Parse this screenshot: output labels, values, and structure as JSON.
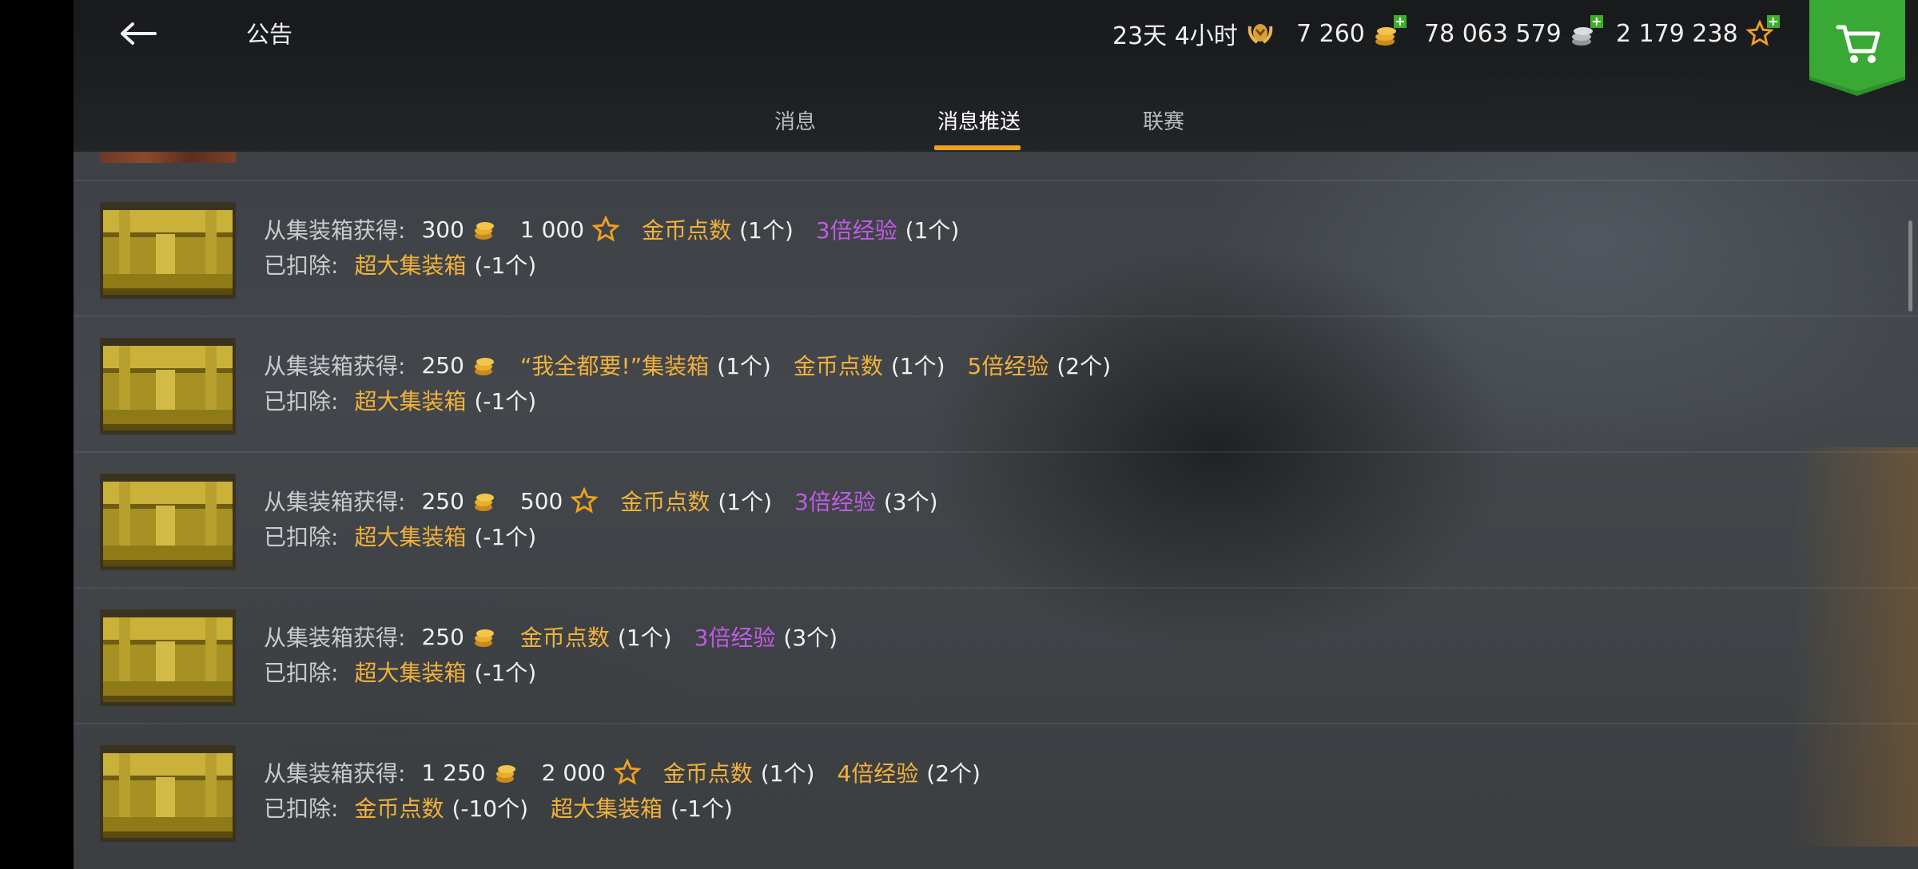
{
  "header": {
    "title": "公告",
    "premium": "23天 4小时",
    "gold": "7 260",
    "credits": "78 063 579",
    "free_xp": "2 179 238"
  },
  "tabs": [
    {
      "label": "消息",
      "active": false
    },
    {
      "label": "消息推送",
      "active": true
    },
    {
      "label": "联赛",
      "active": false
    }
  ],
  "labels": {
    "obtained": "从集装箱获得:",
    "deducted": "已扣除:"
  },
  "colors": {
    "gold_text": "#f1b13c",
    "purple_text": "#c05be6",
    "tab_accent": "#f0a020",
    "plus_green": "#3fae2a"
  },
  "rows": [
    {
      "gold": "300",
      "credits": "1 000",
      "items": [
        {
          "name": "金币点数",
          "count": "(1个)",
          "color": "gold"
        },
        {
          "name": "3倍经验",
          "count": "(1个)",
          "color": "purple"
        }
      ],
      "deducted": [
        {
          "name": "超大集装箱",
          "count": "(-1个)"
        }
      ]
    },
    {
      "gold": "250",
      "items": [
        {
          "name": "“我全都要!”集装箱",
          "count": "(1个)",
          "color": "gold"
        },
        {
          "name": "金币点数",
          "count": "(1个)",
          "color": "gold"
        },
        {
          "name": "5倍经验",
          "count": "(2个)",
          "color": "gold"
        }
      ],
      "deducted": [
        {
          "name": "超大集装箱",
          "count": "(-1个)"
        }
      ]
    },
    {
      "gold": "250",
      "credits": "500",
      "items": [
        {
          "name": "金币点数",
          "count": "(1个)",
          "color": "gold"
        },
        {
          "name": "3倍经验",
          "count": "(3个)",
          "color": "purple"
        }
      ],
      "deducted": [
        {
          "name": "超大集装箱",
          "count": "(-1个)"
        }
      ]
    },
    {
      "gold": "250",
      "items": [
        {
          "name": "金币点数",
          "count": "(1个)",
          "color": "gold"
        },
        {
          "name": "3倍经验",
          "count": "(3个)",
          "color": "purple"
        }
      ],
      "deducted": [
        {
          "name": "超大集装箱",
          "count": "(-1个)"
        }
      ]
    },
    {
      "gold": "1 250",
      "credits": "2 000",
      "items": [
        {
          "name": "金币点数",
          "count": "(1个)",
          "color": "gold"
        },
        {
          "name": "4倍经验",
          "count": "(2个)",
          "color": "gold"
        }
      ],
      "deducted": [
        {
          "name": "金币点数",
          "count": "(-10个)"
        },
        {
          "name": "超大集装箱",
          "count": "(-1个)"
        }
      ]
    }
  ]
}
